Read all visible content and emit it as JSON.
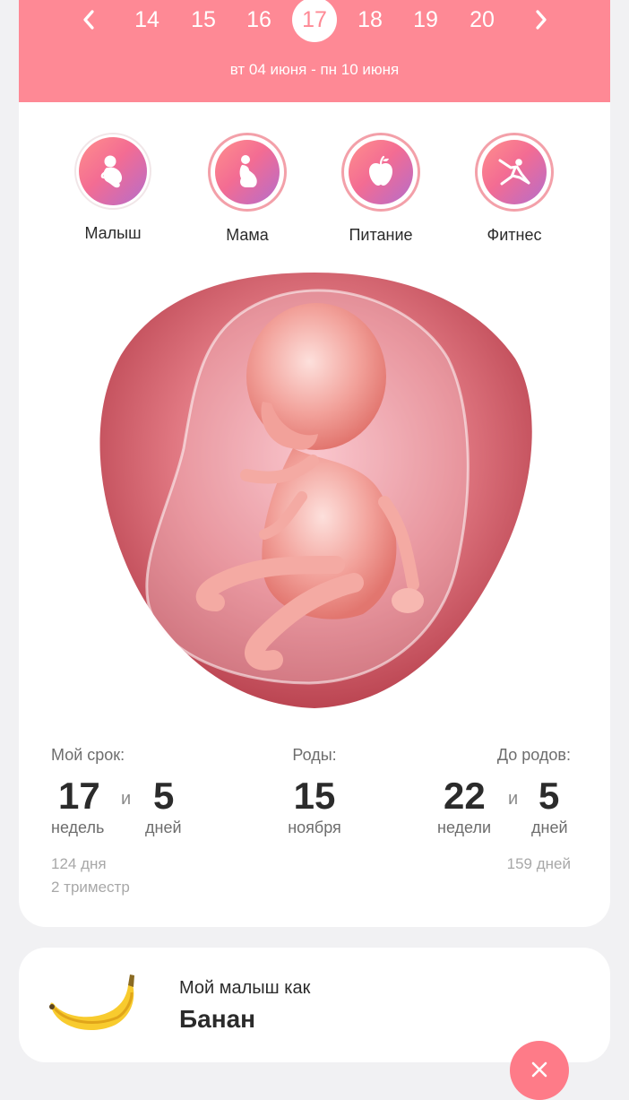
{
  "week_nav": {
    "weeks": [
      "14",
      "15",
      "16",
      "17",
      "18",
      "19",
      "20"
    ],
    "active_week": "17",
    "date_range": "вт 04 июня - пн 10 июня"
  },
  "categories": [
    {
      "label": "Малыш",
      "icon": "baby-icon"
    },
    {
      "label": "Мама",
      "icon": "pregnant-woman-icon"
    },
    {
      "label": "Питание",
      "icon": "apple-icon"
    },
    {
      "label": "Фитнес",
      "icon": "fitness-icon"
    }
  ],
  "stats": {
    "term": {
      "caption": "Мой срок:",
      "weeks_value": "17",
      "connector": "и",
      "days_value": "5",
      "weeks_unit": "недель",
      "days_unit": "дней",
      "total_days": "124 дня",
      "trimester": "2 триместр"
    },
    "due": {
      "caption": "Роды:",
      "day_value": "15",
      "month": "ноября"
    },
    "remaining": {
      "caption": "До родов:",
      "weeks_value": "22",
      "connector": "и",
      "days_value": "5",
      "weeks_unit": "недели",
      "days_unit": "дней",
      "total_days": "159 дней"
    }
  },
  "fruit": {
    "caption": "Мой малыш как",
    "name": "Банан",
    "icon": "banana-image"
  },
  "colors": {
    "header": "#fe8995",
    "accent_gradient_start": "#ff8f8c",
    "accent_gradient_end": "#b56dcb",
    "fab": "#fe7b88"
  },
  "close_button": {
    "icon": "close-icon"
  }
}
